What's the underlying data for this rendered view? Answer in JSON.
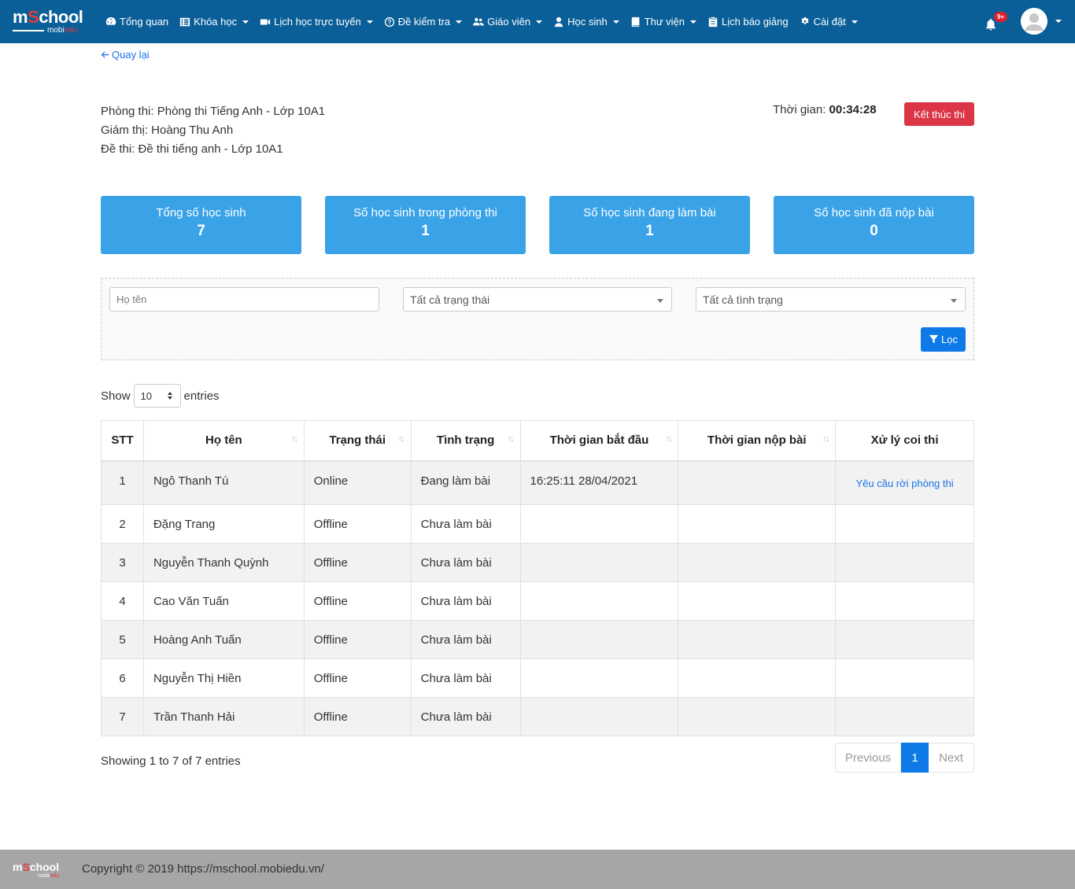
{
  "brand": {
    "name_m": "m",
    "name_s": "S",
    "name_rest": "chool",
    "sub_a": "mobi",
    "sub_b": "edu"
  },
  "nav": {
    "items": [
      {
        "label": "Tổng quan",
        "icon": "dashboard-icon",
        "dropdown": false
      },
      {
        "label": "Khóa học",
        "icon": "list-icon",
        "dropdown": true
      },
      {
        "label": "Lịch học trực tuyến",
        "icon": "video-icon",
        "dropdown": true
      },
      {
        "label": "Đề kiểm tra",
        "icon": "question-icon",
        "dropdown": true
      },
      {
        "label": "Giáo viên",
        "icon": "users-icon",
        "dropdown": true
      },
      {
        "label": "Học sinh",
        "icon": "user-icon",
        "dropdown": true
      },
      {
        "label": "Thư viện",
        "icon": "book-icon",
        "dropdown": true
      },
      {
        "label": "Lịch báo giảng",
        "icon": "clipboard-icon",
        "dropdown": false
      },
      {
        "label": "Cài đặt",
        "icon": "cogs-icon",
        "dropdown": true
      }
    ],
    "notifications": "9+"
  },
  "back_label": "Quay lại",
  "info": {
    "room": "Phòng thi: Phòng thi Tiếng Anh - Lớp 10A1",
    "proctor": "Giám thị: Hoàng Thu Anh",
    "exam": "Đề thi: Đề thi tiếng anh - Lớp 10A1"
  },
  "timer": {
    "label": "Thời gian:",
    "value": "00:34:28"
  },
  "end_button": "Kết thúc thi",
  "stats": [
    {
      "label": "Tổng số học sinh",
      "value": "7"
    },
    {
      "label": "Số học sinh trong phòng thi",
      "value": "1"
    },
    {
      "label": "Số học sinh đang làm bài",
      "value": "1"
    },
    {
      "label": "Số học sinh đã nộp bài",
      "value": "0"
    }
  ],
  "filter": {
    "name_placeholder": "Họ tên",
    "status_value": "Tất cả trạng thái",
    "condition_value": "Tất cả tình trạng",
    "button": "Lọc"
  },
  "show": {
    "before": "Show",
    "value": "10",
    "after": "entries"
  },
  "table": {
    "headers": [
      "STT",
      "Họ tên",
      "Trạng thái",
      "Tình trạng",
      "Thời gian bắt đầu",
      "Thời gian nộp bài",
      "Xử lý coi thi"
    ],
    "rows": [
      {
        "stt": "1",
        "name": "Ngô Thanh Tú",
        "status": "Online",
        "condition": "Đang làm bài",
        "start": "16:25:11 28/04/2021",
        "submit": "",
        "action": "Yêu cầu rời phòng thi"
      },
      {
        "stt": "2",
        "name": "Đặng Trang",
        "status": "Offline",
        "condition": "Chưa làm bài",
        "start": "",
        "submit": "",
        "action": ""
      },
      {
        "stt": "3",
        "name": "Nguyễn Thanh Quỳnh",
        "status": "Offline",
        "condition": "Chưa làm bài",
        "start": "",
        "submit": "",
        "action": ""
      },
      {
        "stt": "4",
        "name": "Cao Văn Tuấn",
        "status": "Offline",
        "condition": "Chưa làm bài",
        "start": "",
        "submit": "",
        "action": ""
      },
      {
        "stt": "5",
        "name": "Hoàng Anh Tuấn",
        "status": "Offline",
        "condition": "Chưa làm bài",
        "start": "",
        "submit": "",
        "action": ""
      },
      {
        "stt": "6",
        "name": "Nguyễn Thị Hiền",
        "status": "Offline",
        "condition": "Chưa làm bài",
        "start": "",
        "submit": "",
        "action": ""
      },
      {
        "stt": "7",
        "name": "Trần Thanh Hải",
        "status": "Offline",
        "condition": "Chưa làm bài",
        "start": "",
        "submit": "",
        "action": ""
      }
    ]
  },
  "showing": "Showing 1 to 7 of 7 entries",
  "pager": {
    "prev": "Previous",
    "current": "1",
    "next": "Next"
  },
  "footer": {
    "copyright": "Copyright © 2019 https://mschool.mobiedu.vn/",
    "logo_a": "m",
    "logo_s": "S",
    "logo_rest": "chool",
    "logo_sub_a": "mobi",
    "logo_sub_b": "edu"
  }
}
